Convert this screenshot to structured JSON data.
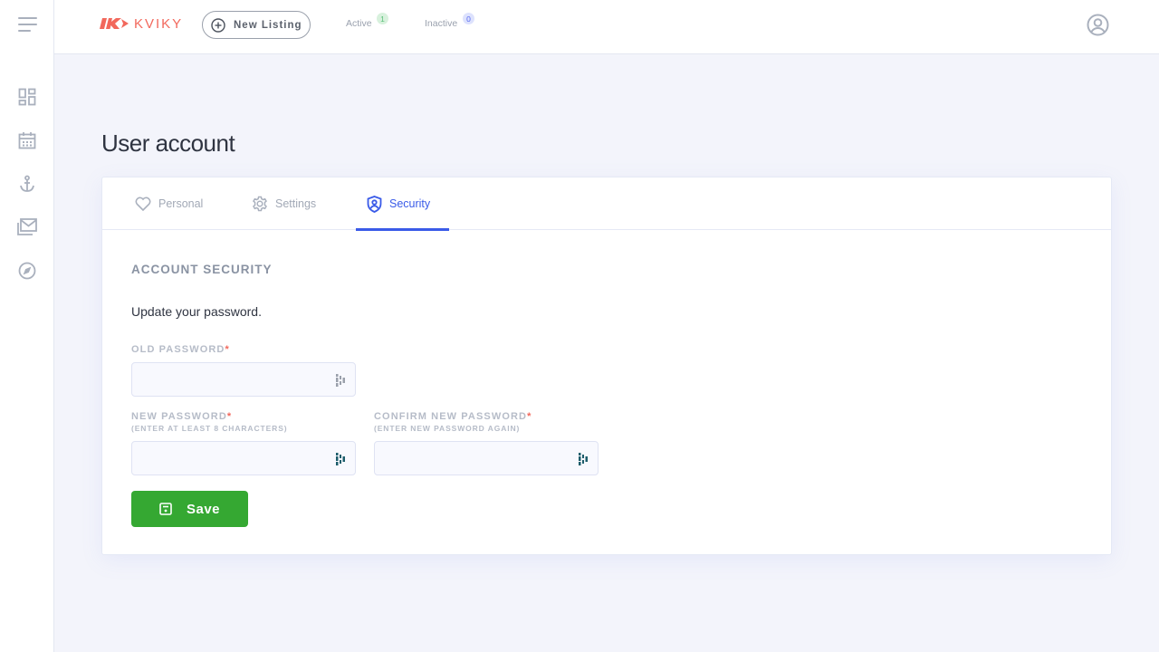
{
  "app": {
    "brand": "KVIKY",
    "brand_color": "#f2685c",
    "accent_color": "#3a5be8",
    "success_color": "#35a832"
  },
  "sidebar": {
    "menu_icon": "hamburger-icon",
    "items": [
      {
        "icon": "dashboard-icon",
        "label": "Dashboard"
      },
      {
        "icon": "calendar-icon",
        "label": "Calendar"
      },
      {
        "icon": "anchor-icon",
        "label": "Boats"
      },
      {
        "icon": "mail-icon",
        "label": "Messages"
      },
      {
        "icon": "compass-icon",
        "label": "Explore"
      }
    ]
  },
  "topbar": {
    "new_listing_label": "New Listing",
    "active_label": "Active",
    "active_count": "1",
    "inactive_label": "Inactive",
    "inactive_count": "0",
    "user_icon": "user-circle-icon"
  },
  "page": {
    "title": "User account",
    "tabs": [
      {
        "label": "Personal",
        "icon": "heart-icon",
        "active": false
      },
      {
        "label": "Settings",
        "icon": "gear-icon",
        "active": false
      },
      {
        "label": "Security",
        "icon": "shield-user-icon",
        "active": true
      }
    ]
  },
  "security": {
    "section_title": "ACCOUNT SECURITY",
    "intro": "Update your password.",
    "required_mark": "*",
    "old_password": {
      "label": "OLD PASSWORD",
      "value": ""
    },
    "new_password": {
      "label": "NEW PASSWORD",
      "hint": "(ENTER AT LEAST 8 CHARACTERS)",
      "value": ""
    },
    "confirm_password": {
      "label": "CONFIRM NEW PASSWORD",
      "hint": "(ENTER NEW PASSWORD AGAIN)",
      "value": ""
    },
    "save_label": "Save"
  }
}
